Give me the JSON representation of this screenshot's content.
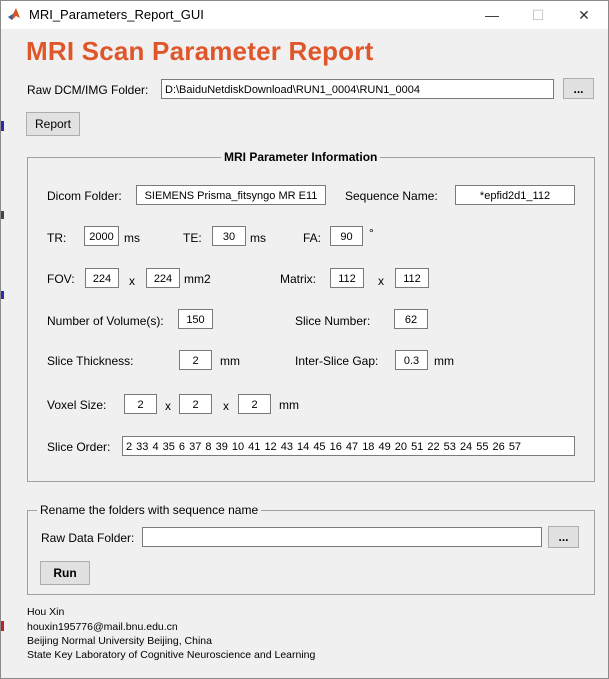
{
  "window": {
    "title": "MRI_Parameters_Report_GUI",
    "minimize_glyph": "—",
    "maximize_glyph": "☐",
    "close_glyph": "✕"
  },
  "header": {
    "title": "MRI Scan Parameter Report",
    "title_color": "#e0562b"
  },
  "raw_folder": {
    "label": "Raw DCM/IMG Folder:",
    "value": "D:\\BaiduNetdiskDownload\\RUN1_0004\\RUN1_0004",
    "browse_label": "..."
  },
  "report_button": "Report",
  "info_panel": {
    "title": "MRI Parameter Information",
    "dicom_folder_label": "Dicom Folder:",
    "dicom_folder_value": "SIEMENS Prisma_fitsyngo MR E11",
    "sequence_name_label": "Sequence Name:",
    "sequence_name_value": "*epfid2d1_112",
    "tr_label": "TR:",
    "tr_value": "2000",
    "tr_unit": "ms",
    "te_label": "TE:",
    "te_value": "30",
    "te_unit": "ms",
    "fa_label": "FA:",
    "fa_value": "90",
    "fa_unit": "°",
    "fov_label": "FOV:",
    "fov_x": "224",
    "fov_sep": "x",
    "fov_y": "224",
    "fov_unit": "mm2",
    "matrix_label": "Matrix:",
    "matrix_x": "112",
    "matrix_sep": "x",
    "matrix_y": "112",
    "volumes_label": "Number of Volume(s):",
    "volumes_value": "150",
    "slice_number_label": "Slice Number:",
    "slice_number_value": "62",
    "thickness_label": "Slice Thickness:",
    "thickness_value": "2",
    "thickness_unit": "mm",
    "gap_label": "Inter-Slice Gap:",
    "gap_value": "0.3",
    "gap_unit": "mm",
    "voxel_label": "Voxel Size:",
    "voxel_x": "2",
    "voxel_sep1": "x",
    "voxel_y": "2",
    "voxel_sep2": "x",
    "voxel_z": "2",
    "voxel_unit": "mm",
    "slice_order_label": "Slice Order:",
    "slice_order_value": "2 33  4 35  6 37  8 39 10 41 12 43 14 45 16 47 18 49 20 51 22 53 24 55 26 57"
  },
  "rename_panel": {
    "title": "Rename the folders with sequence name",
    "raw_data_label": "Raw Data Folder:",
    "raw_data_value": "",
    "browse_label": "...",
    "run_label": "Run"
  },
  "footer": {
    "author": "Hou Xin",
    "email": "houxin195776@mail.bnu.edu.cn",
    "affiliation": "Beijing Normal University Beijing, China",
    "lab": "State Key Laboratory of Cognitive Neuroscience and Learning"
  }
}
